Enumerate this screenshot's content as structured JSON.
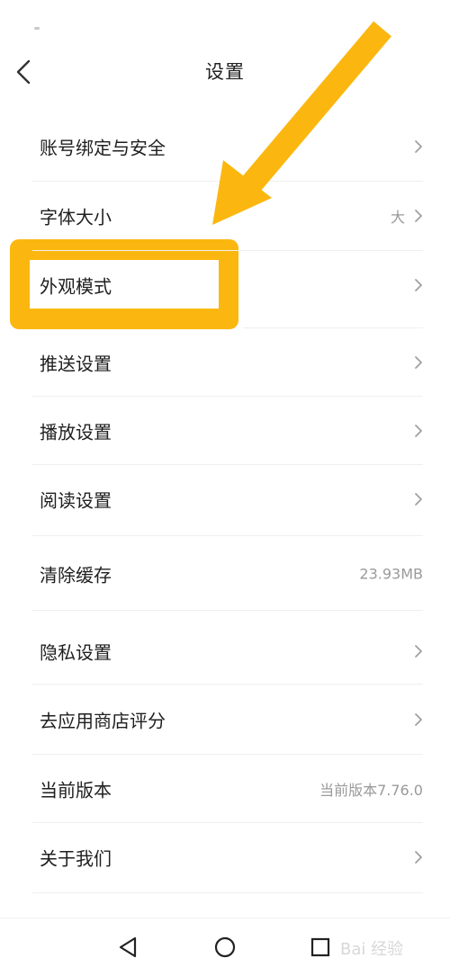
{
  "header": {
    "title": "设置",
    "back_icon": "chevron-left-icon"
  },
  "settings": {
    "items": [
      {
        "label": "账号绑定与安全",
        "value": "",
        "chevron": true
      },
      {
        "label": "字体大小",
        "value": "大",
        "chevron": true
      },
      {
        "label": "外观模式",
        "value": "",
        "chevron": true,
        "highlighted": true
      },
      {
        "label": "推送设置",
        "value": "",
        "chevron": true
      },
      {
        "label": "播放设置",
        "value": "",
        "chevron": true
      },
      {
        "label": "阅读设置",
        "value": "",
        "chevron": true
      },
      {
        "label": "清除缓存",
        "value": "23.93MB",
        "chevron": false
      },
      {
        "label": "隐私设置",
        "value": "",
        "chevron": true
      },
      {
        "label": "去应用商店评分",
        "value": "",
        "chevron": true
      },
      {
        "label": "当前版本",
        "value": "当前版本7.76.0",
        "chevron": false
      },
      {
        "label": "关于我们",
        "value": "",
        "chevron": true
      }
    ]
  },
  "annotation": {
    "color": "#fbb70f",
    "arrow_icon": "arrow-down-left-icon"
  },
  "nav_bar": {
    "back_icon": "triangle-back-icon",
    "home_icon": "circle-home-icon",
    "recents_icon": "square-recents-icon"
  },
  "watermark": {
    "text": "Bai 经验"
  }
}
